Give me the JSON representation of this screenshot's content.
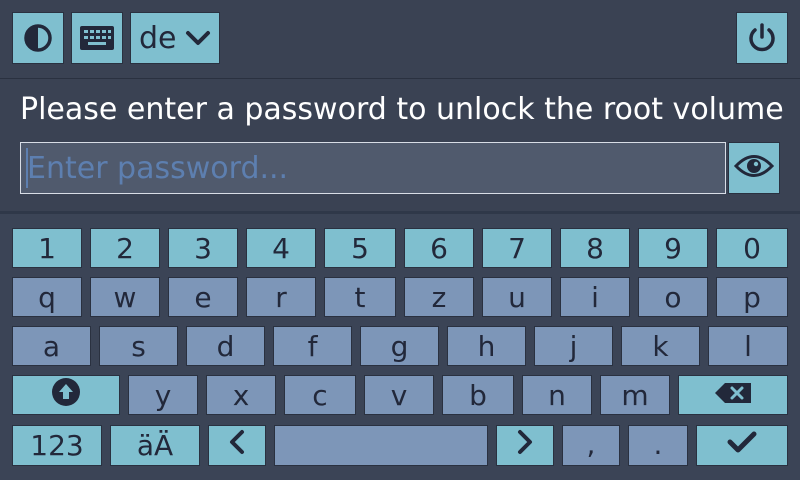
{
  "topbar": {
    "theme_icon": "contrast-icon",
    "keyboard_icon": "keyboard-icon",
    "language": "de",
    "language_icon": "chevron-down-icon",
    "power_icon": "power-icon"
  },
  "prompt": {
    "text": "Please enter a password to unlock the root volume",
    "placeholder": "Enter password...",
    "eye_icon": "eye-icon"
  },
  "keyboard": {
    "row_numbers": [
      "1",
      "2",
      "3",
      "4",
      "5",
      "6",
      "7",
      "8",
      "9",
      "0"
    ],
    "row_q": [
      "q",
      "w",
      "e",
      "r",
      "t",
      "z",
      "u",
      "i",
      "o",
      "p"
    ],
    "row_a": [
      "a",
      "s",
      "d",
      "f",
      "g",
      "h",
      "j",
      "k",
      "l"
    ],
    "row_y": [
      "y",
      "x",
      "c",
      "v",
      "b",
      "n",
      "m"
    ],
    "shift_icon": "shift-arrow-icon",
    "backspace_icon": "backspace-icon",
    "numbers_label": "123",
    "umlaut_label": "äÄ",
    "left_icon": "chevron-left-icon",
    "right_icon": "chevron-right-icon",
    "comma": ",",
    "period": ".",
    "enter_icon": "checkmark-icon"
  },
  "colors": {
    "accent": "#7fbfcf",
    "key_char": "#7d96b8",
    "background": "#2f3849",
    "text_dark": "#22283a"
  }
}
